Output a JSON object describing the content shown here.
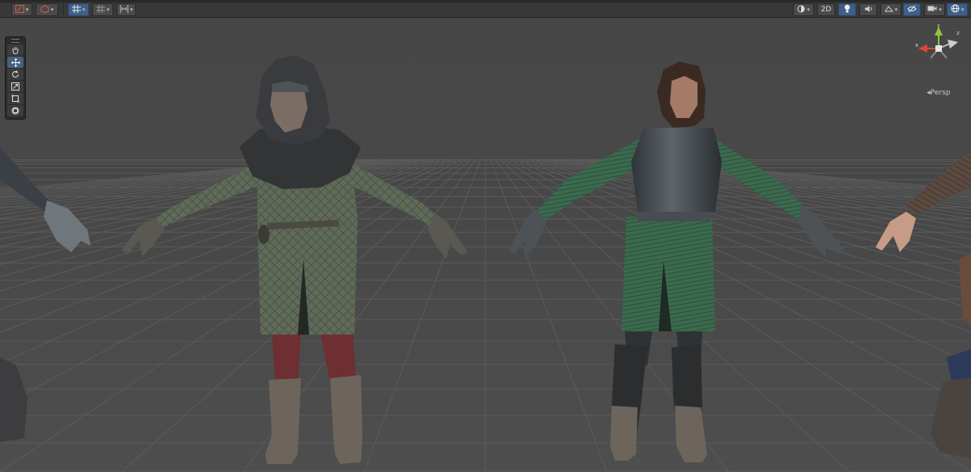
{
  "scene_view": {
    "projection_label": "Persp",
    "gizmo_axes": {
      "x_label": "x",
      "y_label": "y",
      "z_label": "z"
    },
    "toolbar_right": {
      "mode_2d_label": "2D"
    }
  },
  "tools": [
    "hand-tool",
    "move-tool",
    "rotate-tool",
    "scale-tool",
    "rect-tool",
    "transform-tool"
  ],
  "colors": {
    "toolbar_bg": "#383838",
    "viewport_bg": "#464646",
    "grid_line": "#5a5a5a",
    "active_tool": "#46607f",
    "gizmo_x": "#d8483a",
    "gizmo_y": "#8cc63f",
    "gizmo_z": "#3d7ee0"
  }
}
